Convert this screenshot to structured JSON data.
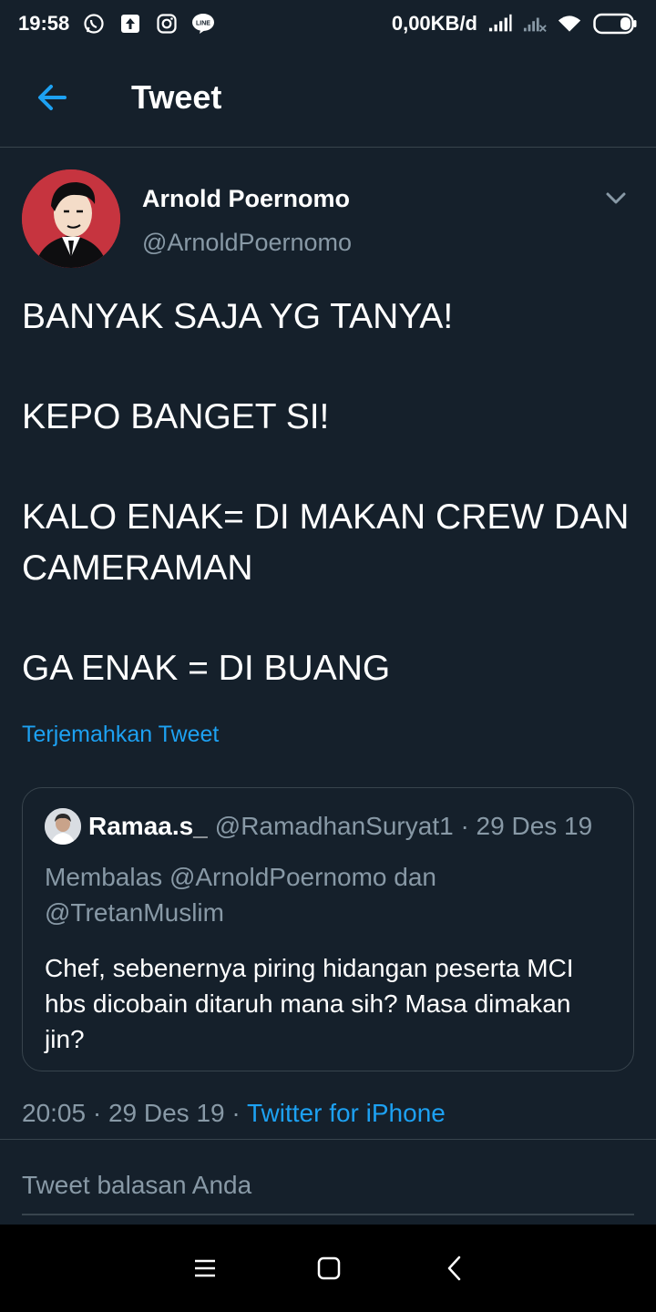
{
  "status_bar": {
    "time": "19:58",
    "network_speed": "0,00KB/d",
    "left_icons": [
      "whatsapp-icon",
      "upload-icon",
      "instagram-icon",
      "line-icon"
    ],
    "right_icons": [
      "signal-icon",
      "signal-no-service-icon",
      "wifi-icon",
      "battery-icon"
    ]
  },
  "header": {
    "title": "Tweet",
    "back_icon": "arrow-left-icon"
  },
  "tweet": {
    "display_name": "Arnold Poernomo",
    "handle": "@ArnoldPoernomo",
    "paragraphs": [
      "BANYAK SAJA YG TANYA!",
      "KEPO BANGET SI!",
      "KALO ENAK= DI MAKAN CREW DAN CAMERAMAN",
      "GA ENAK = DI BUANG"
    ],
    "translate_label": "Terjemahkan Tweet",
    "timestamp": "20:05 · 29 Des 19 · ",
    "source_app": "Twitter for iPhone"
  },
  "quoted_tweet": {
    "display_name": "Ramaa.s_",
    "meta": "@RamadhanSuryat1 · 29 Des 19",
    "reply_context": "Membalas @ArnoldPoernomo dan @TretanMuslim",
    "text": "Chef, sebenernya piring hidangan peserta MCI hbs dicobain ditaruh mana sih? Masa dimakan jin?"
  },
  "reply_box": {
    "placeholder": "Tweet balasan Anda"
  },
  "nav_bar": {
    "icons": [
      "menu-icon",
      "home-icon",
      "back-icon"
    ]
  },
  "colors": {
    "background": "#15202b",
    "accent": "#1da1f2",
    "secondary_text": "#8899a6",
    "border": "#38444d"
  }
}
